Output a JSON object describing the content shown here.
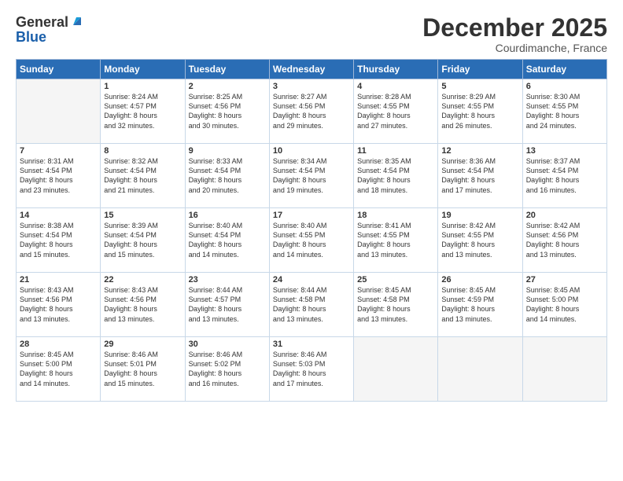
{
  "header": {
    "logo_general": "General",
    "logo_blue": "Blue",
    "month_title": "December 2025",
    "subtitle": "Courdimanche, France"
  },
  "weekdays": [
    "Sunday",
    "Monday",
    "Tuesday",
    "Wednesday",
    "Thursday",
    "Friday",
    "Saturday"
  ],
  "weeks": [
    [
      {
        "day": "",
        "info": ""
      },
      {
        "day": "1",
        "info": "Sunrise: 8:24 AM\nSunset: 4:57 PM\nDaylight: 8 hours\nand 32 minutes."
      },
      {
        "day": "2",
        "info": "Sunrise: 8:25 AM\nSunset: 4:56 PM\nDaylight: 8 hours\nand 30 minutes."
      },
      {
        "day": "3",
        "info": "Sunrise: 8:27 AM\nSunset: 4:56 PM\nDaylight: 8 hours\nand 29 minutes."
      },
      {
        "day": "4",
        "info": "Sunrise: 8:28 AM\nSunset: 4:55 PM\nDaylight: 8 hours\nand 27 minutes."
      },
      {
        "day": "5",
        "info": "Sunrise: 8:29 AM\nSunset: 4:55 PM\nDaylight: 8 hours\nand 26 minutes."
      },
      {
        "day": "6",
        "info": "Sunrise: 8:30 AM\nSunset: 4:55 PM\nDaylight: 8 hours\nand 24 minutes."
      }
    ],
    [
      {
        "day": "7",
        "info": "Sunrise: 8:31 AM\nSunset: 4:54 PM\nDaylight: 8 hours\nand 23 minutes."
      },
      {
        "day": "8",
        "info": "Sunrise: 8:32 AM\nSunset: 4:54 PM\nDaylight: 8 hours\nand 21 minutes."
      },
      {
        "day": "9",
        "info": "Sunrise: 8:33 AM\nSunset: 4:54 PM\nDaylight: 8 hours\nand 20 minutes."
      },
      {
        "day": "10",
        "info": "Sunrise: 8:34 AM\nSunset: 4:54 PM\nDaylight: 8 hours\nand 19 minutes."
      },
      {
        "day": "11",
        "info": "Sunrise: 8:35 AM\nSunset: 4:54 PM\nDaylight: 8 hours\nand 18 minutes."
      },
      {
        "day": "12",
        "info": "Sunrise: 8:36 AM\nSunset: 4:54 PM\nDaylight: 8 hours\nand 17 minutes."
      },
      {
        "day": "13",
        "info": "Sunrise: 8:37 AM\nSunset: 4:54 PM\nDaylight: 8 hours\nand 16 minutes."
      }
    ],
    [
      {
        "day": "14",
        "info": "Sunrise: 8:38 AM\nSunset: 4:54 PM\nDaylight: 8 hours\nand 15 minutes."
      },
      {
        "day": "15",
        "info": "Sunrise: 8:39 AM\nSunset: 4:54 PM\nDaylight: 8 hours\nand 15 minutes."
      },
      {
        "day": "16",
        "info": "Sunrise: 8:40 AM\nSunset: 4:54 PM\nDaylight: 8 hours\nand 14 minutes."
      },
      {
        "day": "17",
        "info": "Sunrise: 8:40 AM\nSunset: 4:55 PM\nDaylight: 8 hours\nand 14 minutes."
      },
      {
        "day": "18",
        "info": "Sunrise: 8:41 AM\nSunset: 4:55 PM\nDaylight: 8 hours\nand 13 minutes."
      },
      {
        "day": "19",
        "info": "Sunrise: 8:42 AM\nSunset: 4:55 PM\nDaylight: 8 hours\nand 13 minutes."
      },
      {
        "day": "20",
        "info": "Sunrise: 8:42 AM\nSunset: 4:56 PM\nDaylight: 8 hours\nand 13 minutes."
      }
    ],
    [
      {
        "day": "21",
        "info": "Sunrise: 8:43 AM\nSunset: 4:56 PM\nDaylight: 8 hours\nand 13 minutes."
      },
      {
        "day": "22",
        "info": "Sunrise: 8:43 AM\nSunset: 4:56 PM\nDaylight: 8 hours\nand 13 minutes."
      },
      {
        "day": "23",
        "info": "Sunrise: 8:44 AM\nSunset: 4:57 PM\nDaylight: 8 hours\nand 13 minutes."
      },
      {
        "day": "24",
        "info": "Sunrise: 8:44 AM\nSunset: 4:58 PM\nDaylight: 8 hours\nand 13 minutes."
      },
      {
        "day": "25",
        "info": "Sunrise: 8:45 AM\nSunset: 4:58 PM\nDaylight: 8 hours\nand 13 minutes."
      },
      {
        "day": "26",
        "info": "Sunrise: 8:45 AM\nSunset: 4:59 PM\nDaylight: 8 hours\nand 13 minutes."
      },
      {
        "day": "27",
        "info": "Sunrise: 8:45 AM\nSunset: 5:00 PM\nDaylight: 8 hours\nand 14 minutes."
      }
    ],
    [
      {
        "day": "28",
        "info": "Sunrise: 8:45 AM\nSunset: 5:00 PM\nDaylight: 8 hours\nand 14 minutes."
      },
      {
        "day": "29",
        "info": "Sunrise: 8:46 AM\nSunset: 5:01 PM\nDaylight: 8 hours\nand 15 minutes."
      },
      {
        "day": "30",
        "info": "Sunrise: 8:46 AM\nSunset: 5:02 PM\nDaylight: 8 hours\nand 16 minutes."
      },
      {
        "day": "31",
        "info": "Sunrise: 8:46 AM\nSunset: 5:03 PM\nDaylight: 8 hours\nand 17 minutes."
      },
      {
        "day": "",
        "info": ""
      },
      {
        "day": "",
        "info": ""
      },
      {
        "day": "",
        "info": ""
      }
    ]
  ]
}
